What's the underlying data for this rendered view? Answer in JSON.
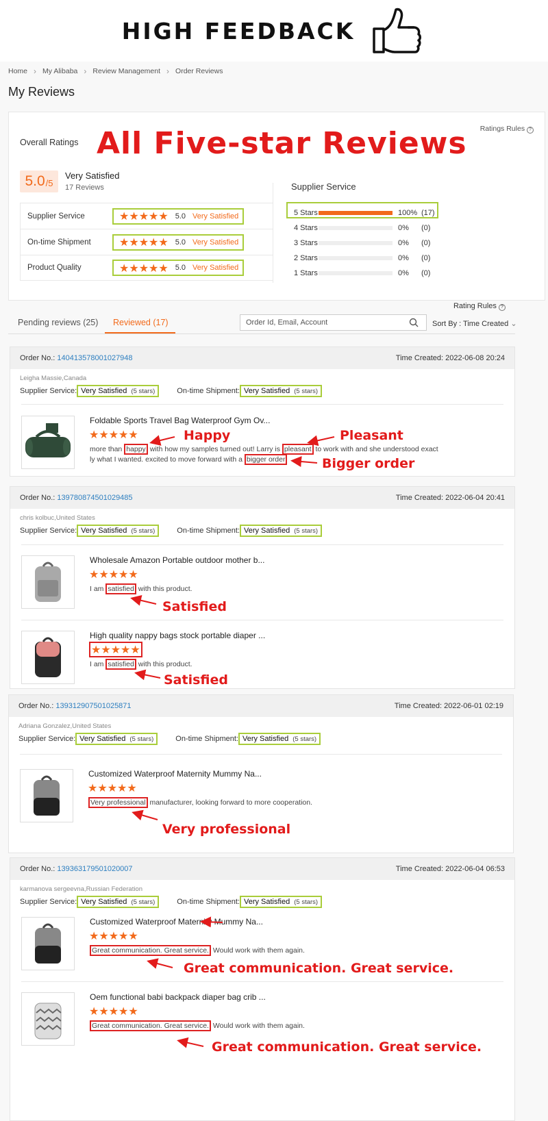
{
  "banner": {
    "text": "HIGH FEEDBACK"
  },
  "breadcrumbs": [
    "Home",
    "My Alibaba",
    "Review Management",
    "Order Reviews"
  ],
  "page_title": "My Reviews",
  "overall": {
    "label": "Overall Ratings",
    "headline": "All Five-star Reviews",
    "rules_label": "Ratings Rules",
    "score": "5.0",
    "score_den": "/5",
    "score_label": "Very Satisfied",
    "review_count": "17 Reviews",
    "rows": [
      {
        "label": "Supplier Service",
        "value": "5.0",
        "text": "Very Satisfied"
      },
      {
        "label": "On-time Shipment",
        "value": "5.0",
        "text": "Very Satisfied"
      },
      {
        "label": "Product Quality",
        "value": "5.0",
        "text": "Very Satisfied"
      }
    ]
  },
  "supplier": {
    "title": "Supplier Service",
    "dist": [
      {
        "label": "5 Stars",
        "pct": "100%",
        "count": "(17)",
        "fill": 1.0
      },
      {
        "label": "4 Stars",
        "pct": "0%",
        "count": "(0)",
        "fill": 0
      },
      {
        "label": "3 Stars",
        "pct": "0%",
        "count": "(0)",
        "fill": 0
      },
      {
        "label": "2 Stars",
        "pct": "0%",
        "count": "(0)",
        "fill": 0
      },
      {
        "label": "1 Stars",
        "pct": "0%",
        "count": "(0)",
        "fill": 0
      }
    ]
  },
  "rating_rules": "Rating Rules",
  "tabs": {
    "pending": "Pending reviews (25)",
    "reviewed": "Reviewed (17)"
  },
  "search": {
    "placeholder": "Order Id, Email, Account"
  },
  "sort": "Sort By : Time Created",
  "labels": {
    "order_no": "Order No.:",
    "time_created": "Time Created:",
    "supplier_service": "Supplier Service:",
    "ontime": "On-time Shipment:",
    "very_satisfied": "Very Satisfied",
    "five_stars": "(5 stars)"
  },
  "orders": [
    {
      "no": "140413578001027948",
      "time": "2022-06-08 20:24",
      "buyer": "Leigha Massie,Canada",
      "items": [
        {
          "title": "Foldable Sports Travel Bag Waterproof Gym Ov...",
          "t1": "more than ",
          "h1": "happy",
          "t2": " with how my samples turned out! Larry is ",
          "h2": "pleasant",
          "t3": " to work with and she understood exact",
          "t4": "ly what I wanted. excited to move forward with a ",
          "h3": "bigger order"
        }
      ]
    },
    {
      "no": "139780874501029485",
      "time": "2022-06-04 20:41",
      "buyer": "chris kolbuc,United States",
      "items": [
        {
          "title": "Wholesale Amazon Portable outdoor mother b...",
          "pre": "I am ",
          "hl": "satisfied",
          "post": " with this product."
        },
        {
          "title": "High quality nappy bags stock portable diaper ...",
          "pre": "I am ",
          "hl": "satisfied",
          "post": " with this product."
        }
      ]
    },
    {
      "no": "139312907501025871",
      "time": "2022-06-01 02:19",
      "buyer": "Adriana Gonzalez,United States",
      "items": [
        {
          "title": "Customized Waterproof Maternity Mummy Na...",
          "pre": "",
          "hl": "Very professional",
          "post": " manufacturer, looking forward to more cooperation."
        }
      ]
    },
    {
      "no": "139363179501020007",
      "time": "2022-06-04 06:53",
      "buyer": "karmanova sergeevna,Russian Federation",
      "items": [
        {
          "title": "Customized Waterproof Maternity Mummy Na...",
          "pre": "",
          "hl": "Great communication. Great service.",
          "post": " Would work with them again."
        },
        {
          "title": "Oem functional babi backpack diaper bag crib ...",
          "pre": "",
          "hl": "Great communication. Great service.",
          "post": " Would work with them again."
        }
      ]
    }
  ],
  "annotations": {
    "happy": "Happy",
    "pleasant": "Pleasant",
    "bigger": "Bigger order",
    "satisfied": "Satisfied",
    "professional": "Very professional",
    "great": "Great communication. Great service."
  },
  "stars": "★★★★★",
  "colors": {
    "accent": "#f26a1b",
    "link": "#2d7fc0",
    "highlight_green": "#a9cd3a",
    "annotation_red": "#e21b1b"
  }
}
